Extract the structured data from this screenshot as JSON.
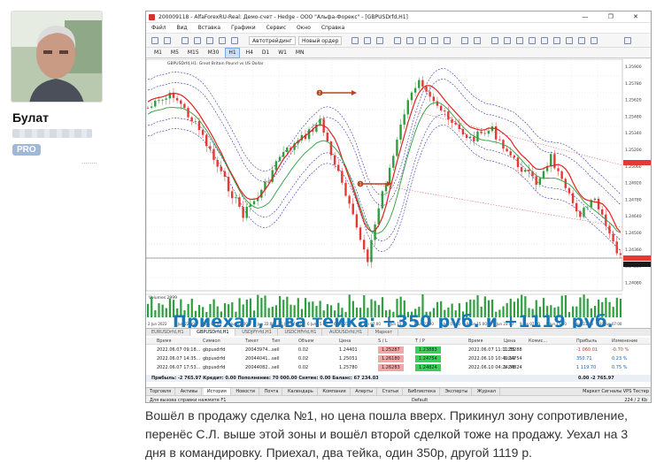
{
  "author": {
    "name": "Булат",
    "badge": "PRO",
    "dots": "........"
  },
  "terminal": {
    "title": "200009118 - AlfaForexRU-Real: Демо-счет - Hedge - ООО \"Альфа-Форекс\" - [GBPUSDrfd,H1]",
    "window_buttons": "— ❐ ✕",
    "menu": [
      "Файл",
      "Вид",
      "Вставка",
      "Графики",
      "Сервис",
      "Окно",
      "Справка"
    ],
    "toolbar": {
      "algo_label": "Автотрейдинг",
      "new_order_label": "Новый ордер"
    },
    "timeframes": [
      "M1",
      "M5",
      "M15",
      "M30",
      "H1",
      "H4",
      "D1",
      "W1",
      "MN"
    ],
    "active_timeframe": "H1",
    "chart_header": "GBPUSDrfd,H1:  Great Britain Pound vs US Dollar",
    "volumes_label": "Volumes 2999",
    "price_ticks": [
      "1.25900",
      "1.25780",
      "1.25620",
      "1.25480",
      "1.25340",
      "1.25200",
      "1.25060",
      "1.24920",
      "1.24780",
      "1.24640",
      "1.24500",
      "1.24360",
      "1.24220",
      "1.24080"
    ],
    "time_ticks": [
      "2 Jun 2022",
      "2 Jun 22:00",
      "3 Jun 06:00",
      "3 Jun 14:00",
      "3 Jun 22:00",
      "6 Jun 07:00",
      "6 Jun 15:00",
      "6 Jun 23:00",
      "7 Jun 07:00",
      "7 Jun 15:00",
      "7 Jun 23:00",
      "8 Jun 07:00",
      "8 Jun 15:00",
      "8 Jun 23:00",
      "9 Jun 07:00",
      "9 Jun 15:00",
      "9 Jun 23:00",
      "10 Jun 07:00"
    ],
    "markers": [
      "2",
      "1"
    ],
    "chart_tabs": [
      "EURUSDrfd,H1",
      "GBPUSDrfd,H1",
      "USDJPYrfd,H1",
      "USDCHFrfd,H1",
      "AUDUSDrfd,H1",
      "Маркет"
    ],
    "active_chart_tab": "GBPUSDrfd,H1",
    "table": {
      "columns": [
        "Время",
        "Символ",
        "Тикет",
        "Тип",
        "Объем",
        "Цена",
        "S / L",
        "T / P",
        "Время",
        "Цена",
        "Комис...",
        "Прибыль",
        "Изменение"
      ],
      "rows": [
        [
          "2022.06.07 09:18...",
          "gbpusdrfd",
          "20043974...",
          "sell",
          "0.02",
          "1.24401",
          "1.25287",
          "1.23883",
          "2022.06.07 11:11:35",
          "1.25288",
          "",
          "-1 060.01",
          "-0.70 %"
        ],
        [
          "2022.06.07 14:35...",
          "gbpusdrfd",
          "20044041...",
          "sell",
          "0.02",
          "1.25051",
          "1.26180",
          "1.24754",
          "2022.06.10 10:49:19",
          "1.24754",
          "",
          "350.71",
          "0.23 %"
        ],
        [
          "2022.06.07 17:53...",
          "gbpusdrfd",
          "20044082...",
          "sell",
          "0.02",
          "1.25780",
          "1.26283",
          "1.24824",
          "2022.06.10 04:24:38",
          "1.24824",
          "",
          "1 119.70",
          "0.75 %"
        ]
      ],
      "summary": "Прибыль: -2 765.97  Кредит: 0.00  Пополнение: 70 000.00  Снятие: 0.00  Баланс: 67 234.03",
      "summary_right": "0.00        -2 765.97"
    },
    "bottom_tabs": [
      "Торговля",
      "Активы",
      "История",
      "Новости",
      "Почта",
      "Календарь",
      "Компания",
      "Алерты",
      "Статьи",
      "Библиотека",
      "Эксперты",
      "Журнал"
    ],
    "active_bottom_tab": "История",
    "bottom_right": "Маркет   Сигналы   VPS   Тестер",
    "status_left": "Для вызова справки нажмите F1",
    "status_mid": "Default",
    "status_right": "224 / 2 Kb",
    "overlay": "Приехал, два тейка: +350 руб. и +1119 руб."
  },
  "caption": "Вошёл в продажу сделка №1, но цена пошла вверх. Прикинул зону сопротивление, перенёс С.Л. выше этой зоны и вошёл второй сделкой тоже на продажу. Уехал на 3 дня в командировку. Приехал, два тейка, один 350р, другой 1119 р.",
  "colors": {
    "bull": "#2e9e3e",
    "bear": "#e53935",
    "ma_red": "#e32020",
    "ma_green": "#2e9e3e",
    "envelope": "#3434b8",
    "overlay_text": "#1976b8"
  }
}
